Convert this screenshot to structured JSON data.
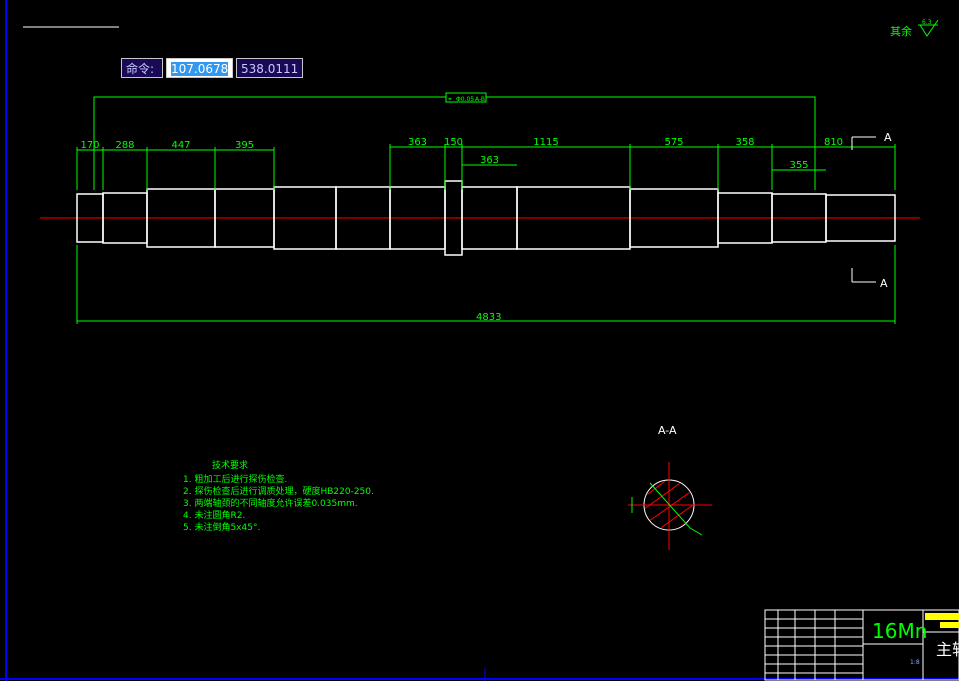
{
  "command_bar": {
    "label": "命令:",
    "x_value": "107.0678",
    "y_value": "538.0111"
  },
  "roughness_note": {
    "label": "其余",
    "value": "6.3"
  },
  "dimensions": {
    "top_row": [
      "170",
      "288",
      "447",
      "395",
      "363",
      "150",
      "1115",
      "575",
      "358",
      "810"
    ],
    "inner": [
      "363",
      "355"
    ],
    "overall": "4833"
  },
  "tolerance_frame": {
    "symbol": "⌖",
    "value": "Φ0.05",
    "datum": "A-B"
  },
  "section_marks": {
    "top": "A",
    "bottom": "A",
    "view_title": "A-A"
  },
  "technical_requirements": {
    "title": "技术要求",
    "items": [
      "1. 粗加工后进行探伤检查.",
      "2. 探伤检查后进行调质处理，硬度HB220-250.",
      "3. 两端轴颈的不同轴度允许误差0.035mm.",
      "4. 未注圆角R2.",
      "5. 未注倒角5x45°."
    ]
  },
  "title_block": {
    "material": "16Mn",
    "part_name": "主轴",
    "scale": "1:8"
  },
  "colors": {
    "background": "#000000",
    "lines": "#00ff00",
    "outline": "#ffffff",
    "centerline": "#ff0000",
    "border": "#0000ff"
  },
  "shaft_segments": [
    {
      "from": 77,
      "to": 103,
      "r": 24
    },
    {
      "from": 103,
      "to": 147,
      "r": 25
    },
    {
      "from": 147,
      "to": 215,
      "r": 29
    },
    {
      "from": 215,
      "to": 274,
      "r": 29
    },
    {
      "from": 274,
      "to": 336,
      "r": 31
    },
    {
      "from": 336,
      "to": 390,
      "r": 31
    },
    {
      "from": 390,
      "to": 445,
      "r": 31
    },
    {
      "from": 445,
      "to": 462,
      "r": 37
    },
    {
      "from": 462,
      "to": 517,
      "r": 31
    },
    {
      "from": 517,
      "to": 630,
      "r": 31
    },
    {
      "from": 630,
      "to": 718,
      "r": 29
    },
    {
      "from": 718,
      "to": 772,
      "r": 25
    },
    {
      "from": 772,
      "to": 826,
      "r": 24
    },
    {
      "from": 826,
      "to": 895,
      "r": 23
    }
  ]
}
